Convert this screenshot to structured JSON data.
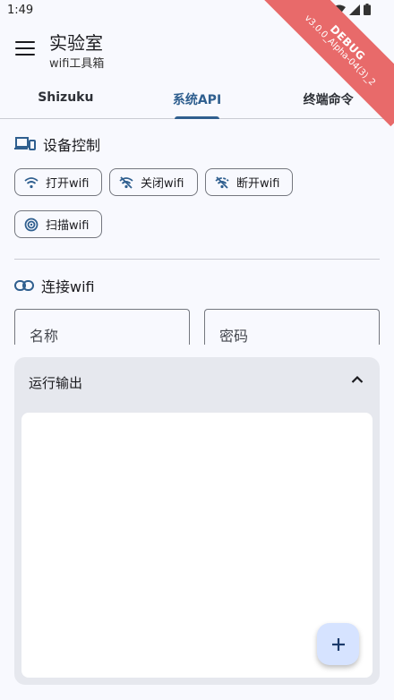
{
  "status": {
    "time": "1:49"
  },
  "debug_banner": {
    "label": "DEBUG",
    "version": "v3.0.0_Alpha-04(3)_2"
  },
  "app_bar": {
    "title": "实验室",
    "subtitle": "wifi工具箱"
  },
  "tabs": [
    {
      "label": "Shizuku",
      "active": false
    },
    {
      "label": "系统API",
      "active": true
    },
    {
      "label": "终端命令",
      "active": false
    }
  ],
  "device_control": {
    "title": "设备控制",
    "buttons": [
      {
        "label": "打开wifi",
        "icon": "wifi-icon"
      },
      {
        "label": "关闭wifi",
        "icon": "wifi-off-icon"
      },
      {
        "label": "断开wifi",
        "icon": "wifi-disconnect-icon"
      },
      {
        "label": "扫描wifi",
        "icon": "radar-icon"
      }
    ]
  },
  "connect_wifi": {
    "title": "连接wifi",
    "name_placeholder": "名称",
    "password_placeholder": "密码"
  },
  "output": {
    "title": "运行输出",
    "content": ""
  },
  "colors": {
    "primary": "#2f5f8f",
    "background": "#f8f9fe",
    "fab": "#d6e3ff",
    "debug": "#e86a6a"
  }
}
